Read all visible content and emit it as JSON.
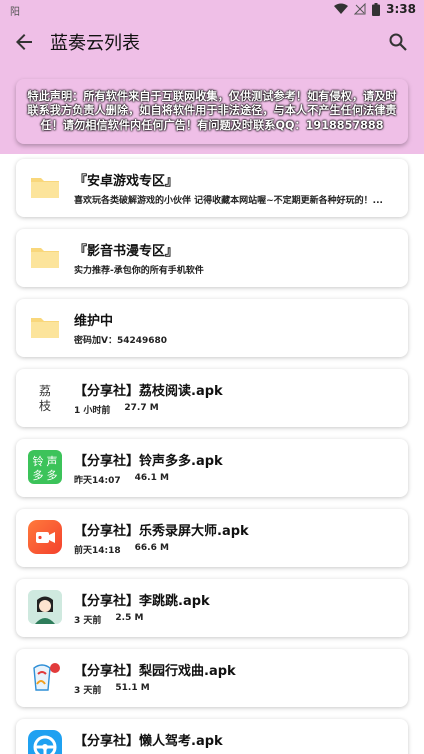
{
  "status_bar": {
    "left_text": "阳",
    "time": "3:38"
  },
  "app_bar": {
    "title": "蓝奏云列表"
  },
  "notice": {
    "text": "特此声明：所有软件来自于互联网收集，仅供测试参考！如有侵权，请及时联系我方负责人删除，如自将软件用于非法途径，与本人不产生任何法律责任！请勿相信软件内任何广告！有问题及时联系QQ：1918857888"
  },
  "items": [
    {
      "icon": "folder-icon",
      "title": "『安卓游戏专区』",
      "subtitle": "喜欢玩各类破解游戏的小伙伴 记得收藏本网站喔~不定期更新各种好玩的！..."
    },
    {
      "icon": "folder-icon",
      "title": "『影音书漫专区』",
      "subtitle": "实力推荐-承包你的所有手机软件"
    },
    {
      "icon": "folder-icon",
      "title": "维护中",
      "subtitle": "密码加V：54249680"
    },
    {
      "icon": "lizhi-app-icon",
      "title": "【分享社】荔枝阅读.apk",
      "time": "1 小时前",
      "size": "27.7 M",
      "icon_text": "荔\n枝"
    },
    {
      "icon": "lingsheng-app-icon",
      "title": "【分享社】铃声多多.apk",
      "time": "昨天14:07",
      "size": "46.1 M",
      "icon_text": "铃声多多"
    },
    {
      "icon": "lexiu-app-icon",
      "title": "【分享社】乐秀录屏大师.apk",
      "time": "前天14:18",
      "size": "66.6 M"
    },
    {
      "icon": "litiaotiao-app-icon",
      "title": "【分享社】李跳跳.apk",
      "time": "3 天前",
      "size": "2.5 M"
    },
    {
      "icon": "liyuan-app-icon",
      "title": "【分享社】梨园行戏曲.apk",
      "time": "3 天前",
      "size": "51.1 M"
    },
    {
      "icon": "lanren-app-icon",
      "title": "【分享社】懒人驾考.apk",
      "time": "",
      "size": ""
    }
  ],
  "colors": {
    "header": "#efbfe7",
    "folder": "#f9d77b"
  }
}
